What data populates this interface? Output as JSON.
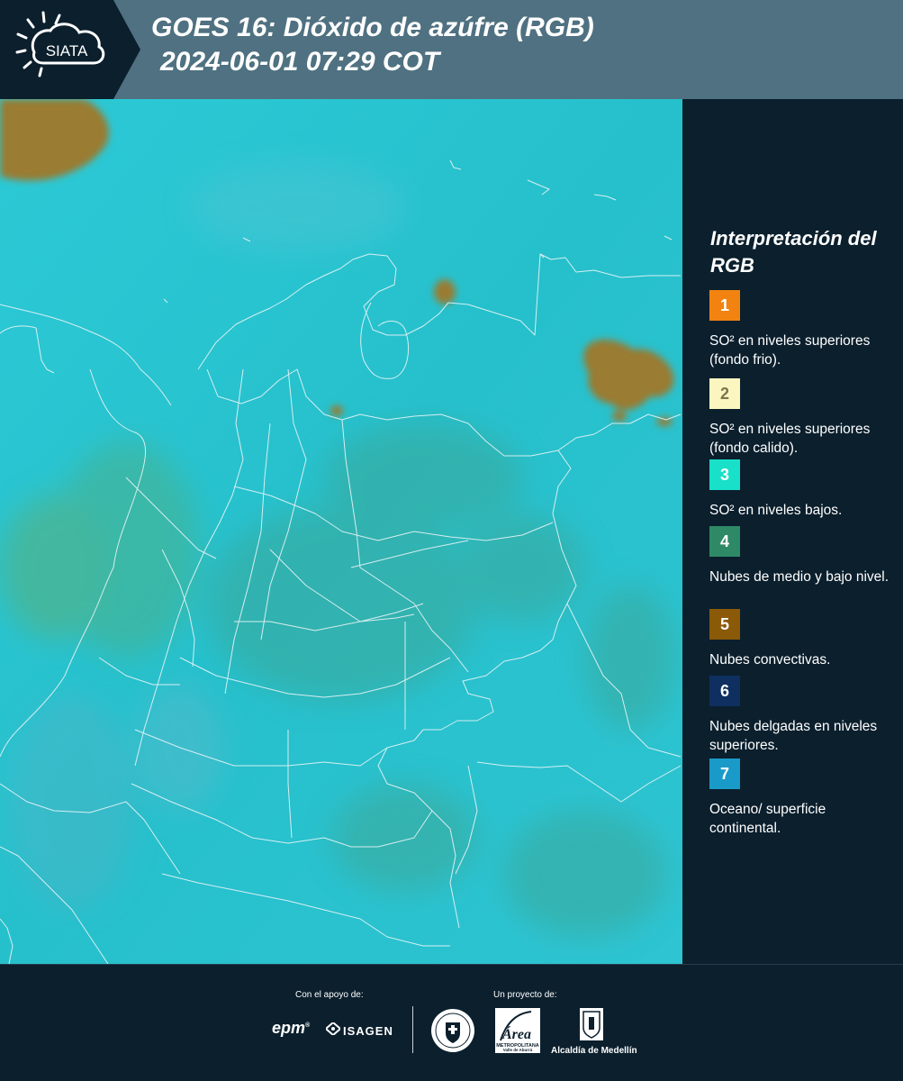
{
  "header": {
    "logo_text": "SIATA",
    "title_line1": "GOES 16: Dióxido de azúfre (RGB)",
    "title_line2": "2024-06-01 07:29 COT"
  },
  "legend": {
    "title": "Interpretación del RGB",
    "items": [
      {
        "number": "1",
        "label": "SO² en niveles superiores (fondo frio).",
        "color": "#f28311",
        "number_color": "#ffffff"
      },
      {
        "number": "2",
        "label": "SO² en niveles superiores (fondo calido).",
        "color": "#fbf6bf",
        "number_color": "#7a7450"
      },
      {
        "number": "3",
        "label": "SO² en niveles bajos.",
        "color": "#19e0c8",
        "number_color": "#ffffff"
      },
      {
        "number": "4",
        "label": "Nubes de medio y bajo nivel.",
        "color": "#2e8a66",
        "number_color": "#ffffff"
      },
      {
        "number": "5",
        "label": "Nubes convectivas.",
        "color": "#8a5a08",
        "number_color": "#ffffff"
      },
      {
        "number": "6",
        "label": "Nubes delgadas en niveles superiores.",
        "color": "#0e2f60",
        "number_color": "#ffffff"
      },
      {
        "number": "7",
        "label": "Oceano/ superficie continental.",
        "color": "#1a9ac8",
        "number_color": "#ffffff"
      }
    ]
  },
  "footer": {
    "support_label": "Con el apoyo de:",
    "project_label": "Un proyecto de:",
    "sponsor_epm": "epm",
    "sponsor_isagen": "ISAGEN",
    "area_text": "Área",
    "area_sub1": "METROPOLITANA",
    "area_sub2": "Valle de Aburrá",
    "alcaldia": "Alcaldía de Medellín"
  },
  "colors": {
    "header_bg": "#4f7181",
    "panel_bg": "#0b1f2d",
    "map_base": "#27c3d0"
  }
}
